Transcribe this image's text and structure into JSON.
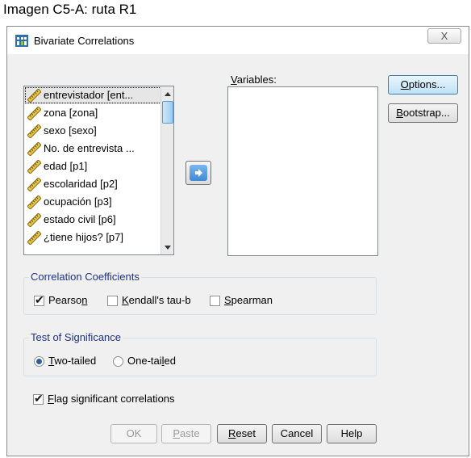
{
  "caption": "Imagen C5-A: ruta R1",
  "window": {
    "title": "Bivariate Correlations",
    "close_glyph": "X"
  },
  "source_list": {
    "items": [
      {
        "label": "entrevistador [ent..."
      },
      {
        "label": "zona [zona]"
      },
      {
        "label": "sexo [sexo]"
      },
      {
        "label": "No. de entrevista ..."
      },
      {
        "label": "edad [p1]"
      },
      {
        "label": "escolaridad [p2]"
      },
      {
        "label": "ocupación [p3]"
      },
      {
        "label": "estado civil [p6]"
      },
      {
        "label": "¿tiene hijos? [p7]"
      }
    ],
    "icon": "ruler-icon"
  },
  "variables": {
    "label_prefix": "",
    "label_underlined": "V",
    "label_rest": "ariables:"
  },
  "buttons": {
    "options": {
      "u": "O",
      "rest": "ptions..."
    },
    "bootstrap": {
      "u": "B",
      "rest": "ootstrap..."
    },
    "ok": "OK",
    "paste": {
      "u": "P",
      "rest": "aste"
    },
    "reset": {
      "u": "R",
      "rest": "eset"
    },
    "cancel": "Cancel",
    "help": "Help"
  },
  "coefficients": {
    "title": "Correlation Coefficients",
    "pearson": {
      "pre": "Pearso",
      "u": "n",
      "checked": true
    },
    "kendall": {
      "u": "K",
      "rest": "endall's tau-b",
      "checked": false
    },
    "spearman": {
      "u": "S",
      "rest": "pearman",
      "checked": false
    }
  },
  "significance": {
    "title": "Test of Significance",
    "two_tailed": {
      "u": "T",
      "rest": "wo-tailed",
      "selected": true
    },
    "one_tailed": {
      "pre": "One-tai",
      "u": "l",
      "rest": "ed",
      "selected": false
    }
  },
  "flag": {
    "u": "F",
    "rest": "lag significant correlations",
    "checked": true
  }
}
